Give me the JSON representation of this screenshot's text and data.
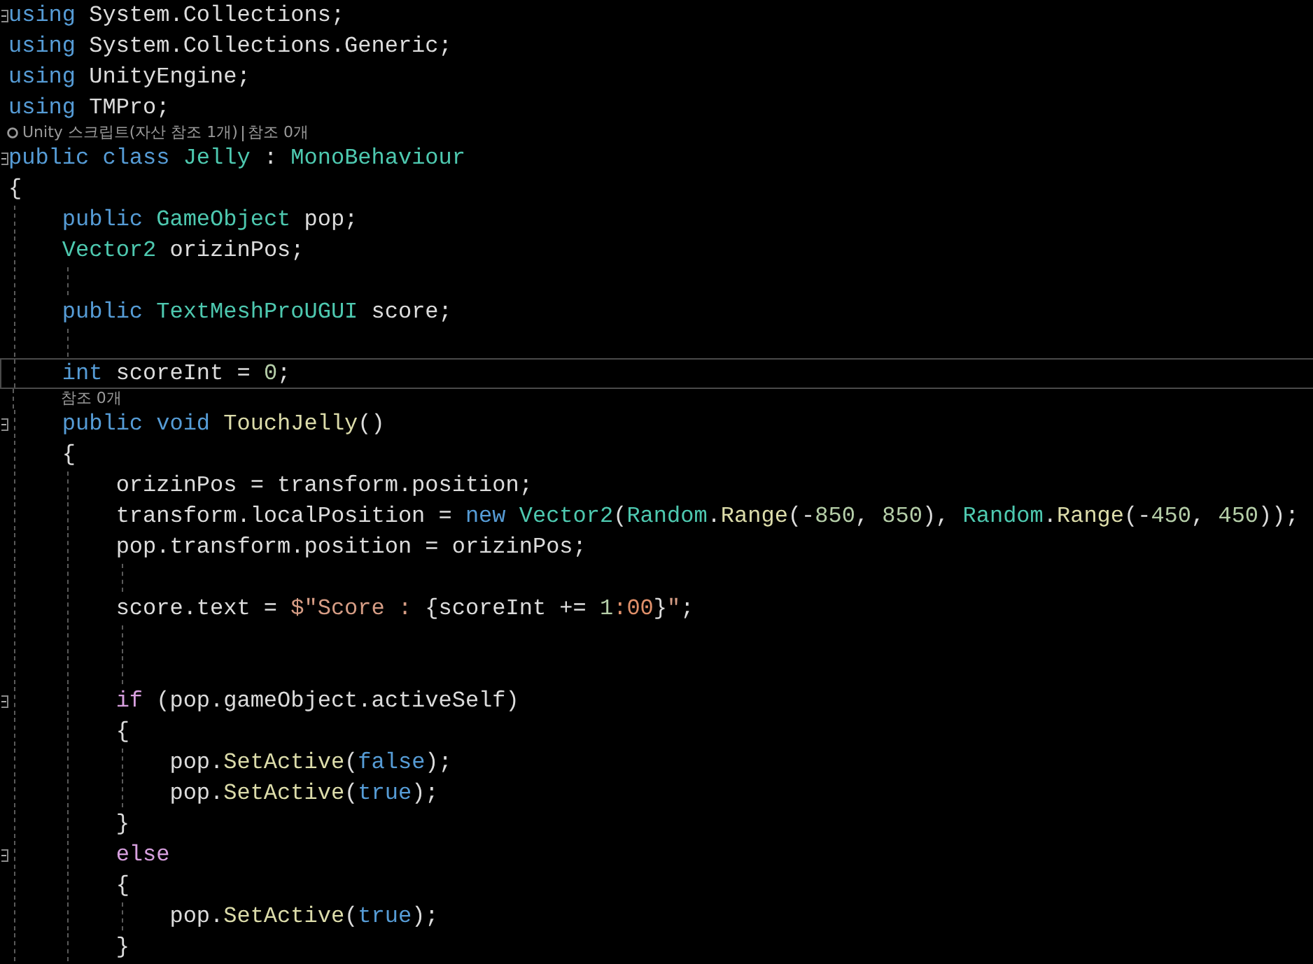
{
  "editor": {
    "lines": [
      {
        "kind": "code",
        "current": false,
        "expanded": true,
        "tokens": [
          {
            "text": "using",
            "kind": "kw"
          },
          {
            "text": " System.Collections;",
            "kind": "plain"
          }
        ]
      },
      {
        "kind": "code",
        "current": false,
        "tokens": [
          {
            "text": "using",
            "kind": "kw"
          },
          {
            "text": " System.Collections.Generic;",
            "kind": "plain"
          }
        ]
      },
      {
        "kind": "code",
        "current": false,
        "tokens": [
          {
            "text": "using",
            "kind": "kw"
          },
          {
            "text": " UnityEngine;",
            "kind": "plain"
          }
        ]
      },
      {
        "kind": "code",
        "current": false,
        "tokens": [
          {
            "text": "using",
            "kind": "kw"
          },
          {
            "text": " TMPro;",
            "kind": "plain"
          }
        ]
      },
      {
        "kind": "lens",
        "parts": [
          "Unity 스크립트(자산 참조 1개)",
          "참조 0개"
        ]
      },
      {
        "kind": "code",
        "current": false,
        "expanded": true,
        "tokens": [
          {
            "text": "public class ",
            "kind": "kw"
          },
          {
            "text": "Jelly",
            "kind": "type"
          },
          {
            "text": " : ",
            "kind": "plain"
          },
          {
            "text": "MonoBehaviour",
            "kind": "type"
          }
        ]
      },
      {
        "kind": "code",
        "current": false,
        "tokens": [
          {
            "text": "{",
            "kind": "plain"
          }
        ]
      },
      {
        "kind": "code",
        "current": false,
        "tokens": [
          {
            "text": "    public ",
            "kind": "kw"
          },
          {
            "text": "GameObject",
            "kind": "type"
          },
          {
            "text": " pop;",
            "kind": "plain"
          }
        ]
      },
      {
        "kind": "code",
        "current": false,
        "tokens": [
          {
            "text": "    Vector2",
            "kind": "type"
          },
          {
            "text": " orizinPos;",
            "kind": "plain"
          }
        ]
      },
      {
        "kind": "blank"
      },
      {
        "kind": "code",
        "current": false,
        "tokens": [
          {
            "text": "    public ",
            "kind": "kw"
          },
          {
            "text": "TextMeshProUGUI",
            "kind": "type"
          },
          {
            "text": " score;",
            "kind": "plain"
          }
        ]
      },
      {
        "kind": "blank"
      },
      {
        "kind": "code",
        "current": true,
        "tokens": [
          {
            "text": "    int",
            "kind": "kw"
          },
          {
            "text": " scoreInt = ",
            "kind": "plain"
          },
          {
            "text": "0",
            "kind": "num"
          },
          {
            "text": ";",
            "kind": "plain"
          }
        ]
      },
      {
        "kind": "lens",
        "parts": [
          "참조 0개"
        ]
      },
      {
        "kind": "code",
        "current": false,
        "expanded": true,
        "tokens": [
          {
            "text": "    public void ",
            "kind": "kw"
          },
          {
            "text": "TouchJelly",
            "kind": "fn"
          },
          {
            "text": "()",
            "kind": "plain"
          }
        ]
      },
      {
        "kind": "code",
        "current": false,
        "tokens": [
          {
            "text": "    {",
            "kind": "plain"
          }
        ]
      },
      {
        "kind": "code",
        "current": false,
        "tokens": [
          {
            "text": "        orizinPos = transform.position;",
            "kind": "plain"
          }
        ]
      },
      {
        "kind": "code",
        "current": false,
        "tokens": [
          {
            "text": "        transform.localPosition = ",
            "kind": "plain"
          },
          {
            "text": "new ",
            "kind": "kw"
          },
          {
            "text": "Vector2",
            "kind": "type"
          },
          {
            "text": "(",
            "kind": "plain"
          },
          {
            "text": "Random",
            "kind": "type"
          },
          {
            "text": ".",
            "kind": "plain"
          },
          {
            "text": "Range",
            "kind": "fn"
          },
          {
            "text": "(-",
            "kind": "plain"
          },
          {
            "text": "850",
            "kind": "num"
          },
          {
            "text": ", ",
            "kind": "plain"
          },
          {
            "text": "850",
            "kind": "num"
          },
          {
            "text": "), ",
            "kind": "plain"
          },
          {
            "text": "Random",
            "kind": "type"
          },
          {
            "text": ".",
            "kind": "plain"
          },
          {
            "text": "Range",
            "kind": "fn"
          },
          {
            "text": "(-",
            "kind": "plain"
          },
          {
            "text": "450",
            "kind": "num"
          },
          {
            "text": ", ",
            "kind": "plain"
          },
          {
            "text": "450",
            "kind": "num"
          },
          {
            "text": "));",
            "kind": "plain"
          }
        ]
      },
      {
        "kind": "code",
        "current": false,
        "tokens": [
          {
            "text": "        pop.transform.position = orizinPos;",
            "kind": "plain"
          }
        ]
      },
      {
        "kind": "blank"
      },
      {
        "kind": "code",
        "current": false,
        "tokens": [
          {
            "text": "        score.text = ",
            "kind": "plain"
          },
          {
            "text": "$\"Score : ",
            "kind": "str"
          },
          {
            "text": "{scoreInt += ",
            "kind": "plain"
          },
          {
            "text": "1",
            "kind": "num"
          },
          {
            "text": ":00",
            "kind": "fmt"
          },
          {
            "text": "}",
            "kind": "plain"
          },
          {
            "text": "\"",
            "kind": "str"
          },
          {
            "text": ";",
            "kind": "plain"
          }
        ]
      },
      {
        "kind": "blank"
      },
      {
        "kind": "blank"
      },
      {
        "kind": "code",
        "current": false,
        "expanded": true,
        "tokens": [
          {
            "text": "        if",
            "kind": "ctl"
          },
          {
            "text": " (pop.gameObject.activeSelf)",
            "kind": "plain"
          }
        ]
      },
      {
        "kind": "code",
        "current": false,
        "tokens": [
          {
            "text": "        {",
            "kind": "plain"
          }
        ]
      },
      {
        "kind": "code",
        "current": false,
        "tokens": [
          {
            "text": "            pop.",
            "kind": "plain"
          },
          {
            "text": "SetActive",
            "kind": "fn"
          },
          {
            "text": "(",
            "kind": "plain"
          },
          {
            "text": "false",
            "kind": "kw"
          },
          {
            "text": ");",
            "kind": "plain"
          }
        ]
      },
      {
        "kind": "code",
        "current": false,
        "tokens": [
          {
            "text": "            pop.",
            "kind": "plain"
          },
          {
            "text": "SetActive",
            "kind": "fn"
          },
          {
            "text": "(",
            "kind": "plain"
          },
          {
            "text": "true",
            "kind": "kw"
          },
          {
            "text": ");",
            "kind": "plain"
          }
        ]
      },
      {
        "kind": "code",
        "current": false,
        "tokens": [
          {
            "text": "        }",
            "kind": "plain"
          }
        ]
      },
      {
        "kind": "code",
        "current": false,
        "expanded": true,
        "tokens": [
          {
            "text": "        else",
            "kind": "ctl"
          }
        ]
      },
      {
        "kind": "code",
        "current": false,
        "tokens": [
          {
            "text": "        {",
            "kind": "plain"
          }
        ]
      },
      {
        "kind": "code",
        "current": false,
        "tokens": [
          {
            "text": "            pop.",
            "kind": "plain"
          },
          {
            "text": "SetActive",
            "kind": "fn"
          },
          {
            "text": "(",
            "kind": "plain"
          },
          {
            "text": "true",
            "kind": "kw"
          },
          {
            "text": ");",
            "kind": "plain"
          }
        ]
      },
      {
        "kind": "code",
        "current": false,
        "tokens": [
          {
            "text": "        }",
            "kind": "plain"
          }
        ]
      }
    ]
  }
}
